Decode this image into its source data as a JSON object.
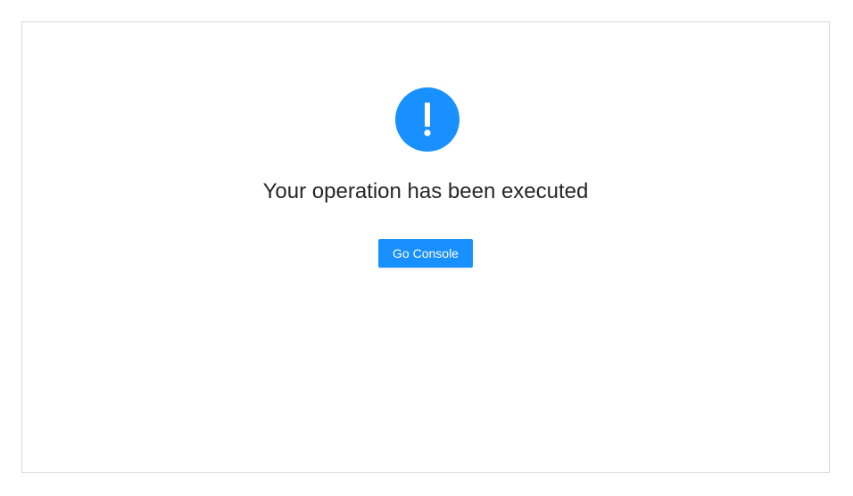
{
  "result": {
    "status": "info",
    "icon": "exclamation-circle-icon",
    "title": "Your operation has been executed",
    "button_label": "Go Console"
  },
  "colors": {
    "accent": "#1890ff",
    "border": "#d9d9d9",
    "title_text": "#262626"
  }
}
